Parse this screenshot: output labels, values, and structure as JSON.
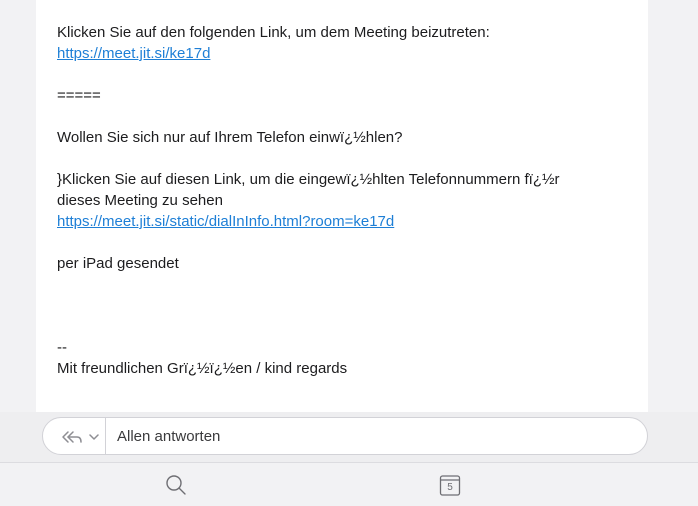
{
  "message": {
    "join_text": "Klicken Sie auf den folgenden Link, um dem Meeting beizutreten:",
    "join_link": "https://meet.jit.si/ke17d",
    "separator": "=====",
    "phone_question": "Wollen Sie sich nur auf Ihrem Telefon einwï¿½hlen?",
    "phone_text_1": "}Klicken Sie auf diesen Link, um die eingewï¿½hlten Telefonnummern fï¿½r",
    "phone_text_2": "dieses Meeting zu sehen",
    "phone_link": "https://meet.jit.si/static/dialInInfo.html?room=ke17d",
    "sent_from": "per iPad gesendet",
    "signature_dash": "--",
    "signature_greeting": "Mit freundlichen Grï¿½ï¿½en / kind regards"
  },
  "reply_bar": {
    "label": "Allen antworten",
    "icons": [
      "reply-all-icon",
      "chevron-down-icon"
    ]
  },
  "tab_bar": {
    "items": [
      {
        "icon": "search-icon"
      },
      {
        "icon": "calendar-icon",
        "badge": "5"
      }
    ]
  },
  "colors": {
    "link": "#1e7fd6",
    "background": "#f2f2f4",
    "card": "#ffffff"
  }
}
